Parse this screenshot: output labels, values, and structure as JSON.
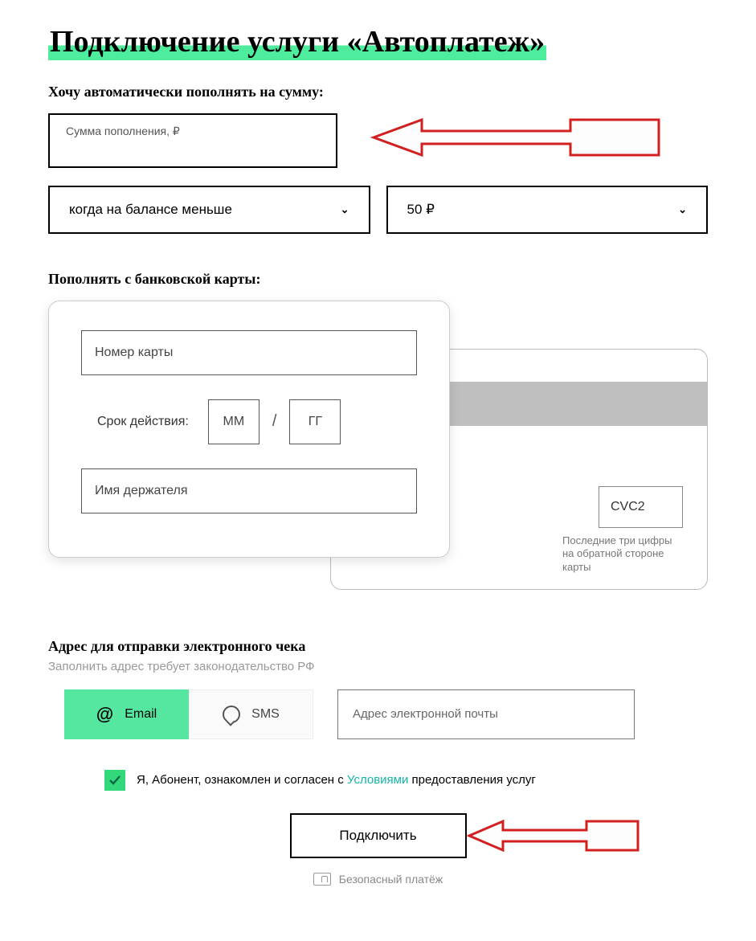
{
  "title": "Подключение услуги «Автоплатеж»",
  "amount": {
    "label": "Хочу автоматически пополнять на сумму:",
    "placeholder": "Сумма пополнения, ₽"
  },
  "condition": {
    "when_label": "когда на балансе меньше",
    "value": "50 ₽"
  },
  "card": {
    "section_label": "Пополнять с банковской карты:",
    "number_placeholder": "Номер карты",
    "expiry_label": "Срок действия:",
    "mm": "ММ",
    "yy": "ГГ",
    "holder_placeholder": "Имя держателя",
    "cvc_placeholder": "CVC2",
    "cvc_hint": "Последние три цифры на обратной стороне карты"
  },
  "receipt": {
    "heading": "Адрес для отправки электронного чека",
    "sub": "Заполнить адрес требует законодательство РФ",
    "tab_email": "Email",
    "tab_sms": "SMS",
    "email_placeholder": "Адрес электронной почты"
  },
  "consent": {
    "prefix": "Я, Абонент, ознакомлен и согласен с ",
    "link": "Условиями",
    "suffix": " предоставления услуг"
  },
  "submit": "Подключить",
  "secure": "Безопасный платёж",
  "colors": {
    "accent": "#4eed9e",
    "link": "#16b3a6",
    "arrow": "#d22020"
  }
}
